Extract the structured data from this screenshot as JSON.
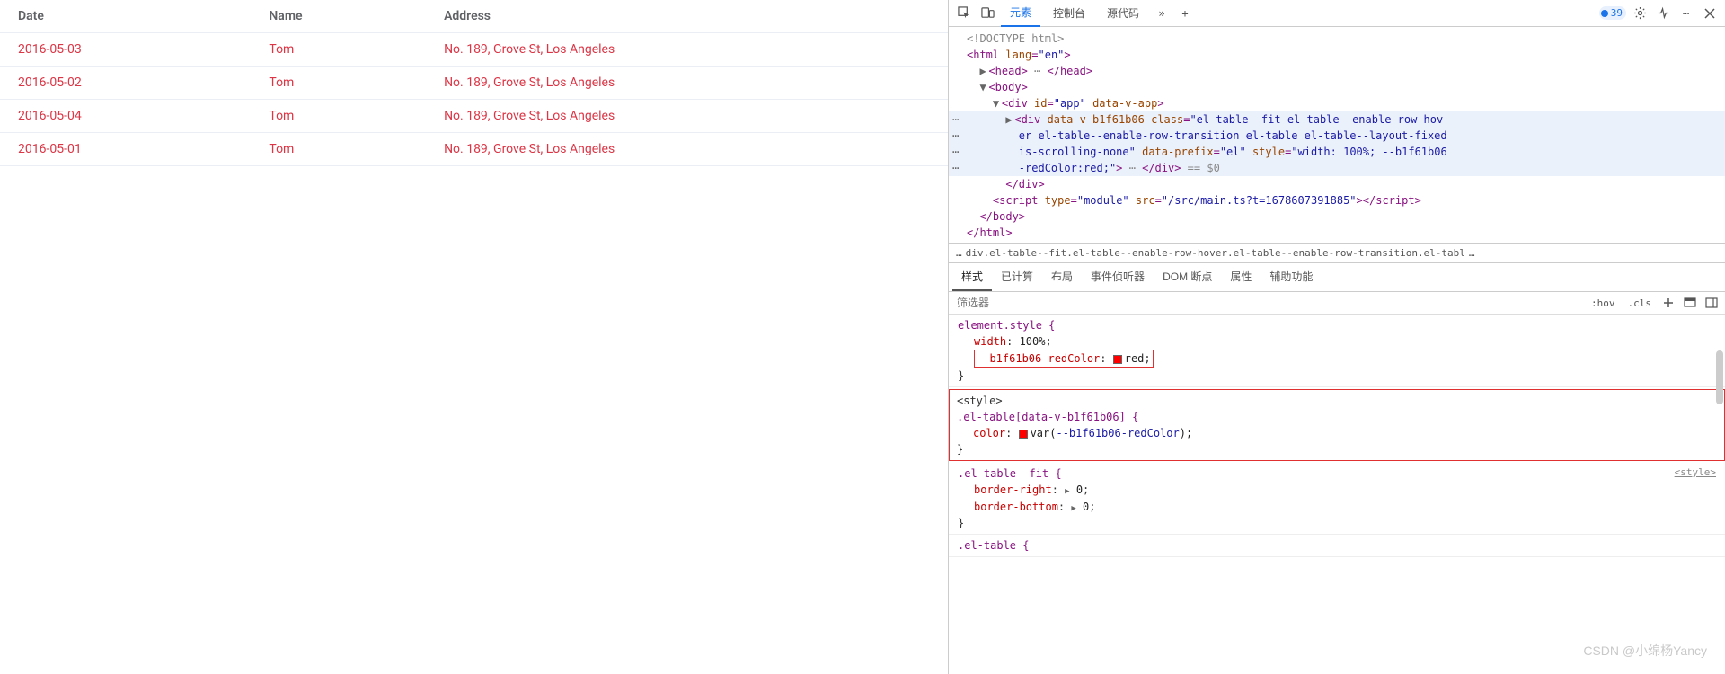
{
  "table": {
    "headers": [
      "Date",
      "Name",
      "Address"
    ],
    "rows": [
      {
        "date": "2016-05-03",
        "name": "Tom",
        "address": "No. 189, Grove St, Los Angeles"
      },
      {
        "date": "2016-05-02",
        "name": "Tom",
        "address": "No. 189, Grove St, Los Angeles"
      },
      {
        "date": "2016-05-04",
        "name": "Tom",
        "address": "No. 189, Grove St, Los Angeles"
      },
      {
        "date": "2016-05-01",
        "name": "Tom",
        "address": "No. 189, Grove St, Los Angeles"
      }
    ]
  },
  "devtools": {
    "tabs": {
      "elements": "元素",
      "console": "控制台",
      "sources": "源代码"
    },
    "moreGlyph": "»",
    "plusGlyph": "+",
    "issuesCount": "39",
    "dom": {
      "doctype": "<!DOCTYPE html>",
      "htmlOpen_a": "<html ",
      "htmlOpen_attr": "lang",
      "htmlOpen_val": "\"en\"",
      "htmlOpen_c": ">",
      "headOpen": "<head>",
      "headEllipsis": " ⋯ ",
      "headClose": "</head>",
      "bodyOpen": "<body>",
      "divAppOpen_a": "<div ",
      "divApp_id": "id",
      "divApp_idv": "\"app\"",
      "divApp_dv": "data-v-app",
      "divAppOpen_c": ">",
      "divEl_a": "<div ",
      "divEl_dv": "data-v-b1f61b06",
      "divEl_cls": "class",
      "divEl_clsv1": "\"el-table--fit el-table--enable-row-hov",
      "divEl_clsv2": "er el-table--enable-row-transition el-table el-table--layout-fixed",
      "divEl_clsv3": " is-scrolling-none\"",
      "divEl_pfx": "data-prefix",
      "divEl_pfxv": "\"el\"",
      "divEl_sty": "style",
      "divEl_styv1": "\"width: 100%; --b1f61b06",
      "divEl_styv2": "-redColor:red;\"",
      "divEl_c": ">",
      "divEl_ell": " ⋯ ",
      "divEl_close": "</div>",
      "eqDollar": " == $0",
      "divAppClose": "</div>",
      "scriptOpen_a": "<script ",
      "script_type": "type",
      "script_typev": "\"module\"",
      "script_src": "src",
      "script_srcv": "\"/src/main.ts?t=1678607391885\"",
      "scriptOpen_c": ">",
      "scriptClose": "</script>",
      "bodyClose": "</body>",
      "htmlClose": "</html>"
    },
    "crumb": {
      "ell": "…",
      "text": "div.el-table--fit.el-table--enable-row-hover.el-table--enable-row-transition.el-tabl",
      "more": "…"
    },
    "subtabs": {
      "styles": "样式",
      "computed": "已计算",
      "layout": "布局",
      "listeners": "事件侦听器",
      "dom": "DOM 断点",
      "props": "属性",
      "a11y": "辅助功能"
    },
    "filter": {
      "placeholder": "筛选器",
      "hov": ":hov",
      "cls": ".cls"
    },
    "styles": {
      "elStyle": "element.style {",
      "width_n": "width",
      "width_v": "100%",
      "redvar_n": "--b1f61b06-redColor",
      "redvar_v": "red",
      "brace_close": "}",
      "r2_sel": ".el-table[data-v-b1f61b06] {",
      "r2_src": "<style>",
      "r2_color_n": "color",
      "r2_color_fn": "var(",
      "r2_color_var": "--b1f61b06-redColor",
      "r2_color_end": ");",
      "r3_sel": ".el-table--fit {",
      "r3_src": "<style>",
      "r3_br_n": "border-right",
      "r3_br_v": "0",
      "r3_bb_n": "border-bottom",
      "r3_bb_v": "0",
      "r4_sel": ".el-table {"
    }
  },
  "watermark": "CSDN @小绵杨Yancy"
}
